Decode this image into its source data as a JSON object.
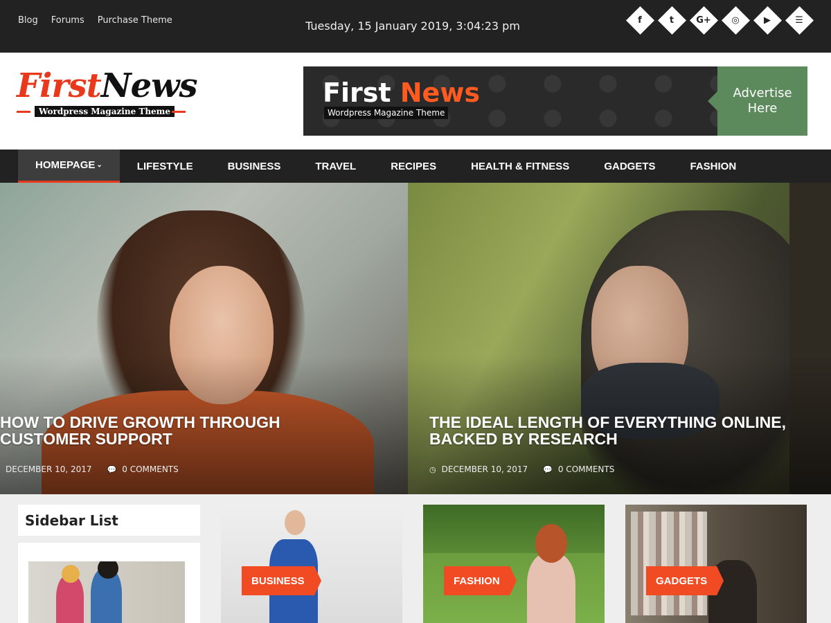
{
  "topbar": {
    "links": [
      "Blog",
      "Forums",
      "Purchase Theme"
    ],
    "datetime": "Tuesday, 15 January 2019, 3:04:23 pm",
    "socials": [
      {
        "icon": "facebook-icon",
        "glyph": "f"
      },
      {
        "icon": "twitter-icon",
        "glyph": "t"
      },
      {
        "icon": "google-plus-icon",
        "glyph": "G+"
      },
      {
        "icon": "instagram-icon",
        "glyph": "◎"
      },
      {
        "icon": "youtube-icon",
        "glyph": "▶"
      },
      {
        "icon": "rss-icon",
        "glyph": "☰"
      }
    ]
  },
  "header": {
    "logo_first": "First",
    "logo_news": "News",
    "logo_tagline": "Wordpress Magazine Theme",
    "ad": {
      "title_first": "First",
      "title_news": "News",
      "subtitle": "Wordpress Magazine Theme",
      "cta": "Advertise Here"
    }
  },
  "nav": {
    "items": [
      "HOMEPAGE",
      "LIFESTYLE",
      "BUSINESS",
      "TRAVEL",
      "RECIPES",
      "HEALTH & FITNESS",
      "GADGETS",
      "FASHION"
    ],
    "active": "HOMEPAGE",
    "caret": "⌄"
  },
  "slides": [
    {
      "title": "HOW TO DRIVE GROWTH THROUGH CUSTOMER SUPPORT",
      "date": "DECEMBER 10, 2017",
      "comments": "0 COMMENTS"
    },
    {
      "title": "THE IDEAL LENGTH OF EVERYTHING ONLINE, BACKED BY RESEARCH",
      "date": "DECEMBER 10, 2017",
      "comments": "0 COMMENTS"
    }
  ],
  "sidebar": {
    "title": "Sidebar List"
  },
  "cards": [
    {
      "category": "BUSINESS"
    },
    {
      "category": "FASHION"
    },
    {
      "category": "GADGETS"
    }
  ],
  "colors": {
    "accent": "#e8391d",
    "dark": "#222222",
    "badge": "#f04b23"
  }
}
